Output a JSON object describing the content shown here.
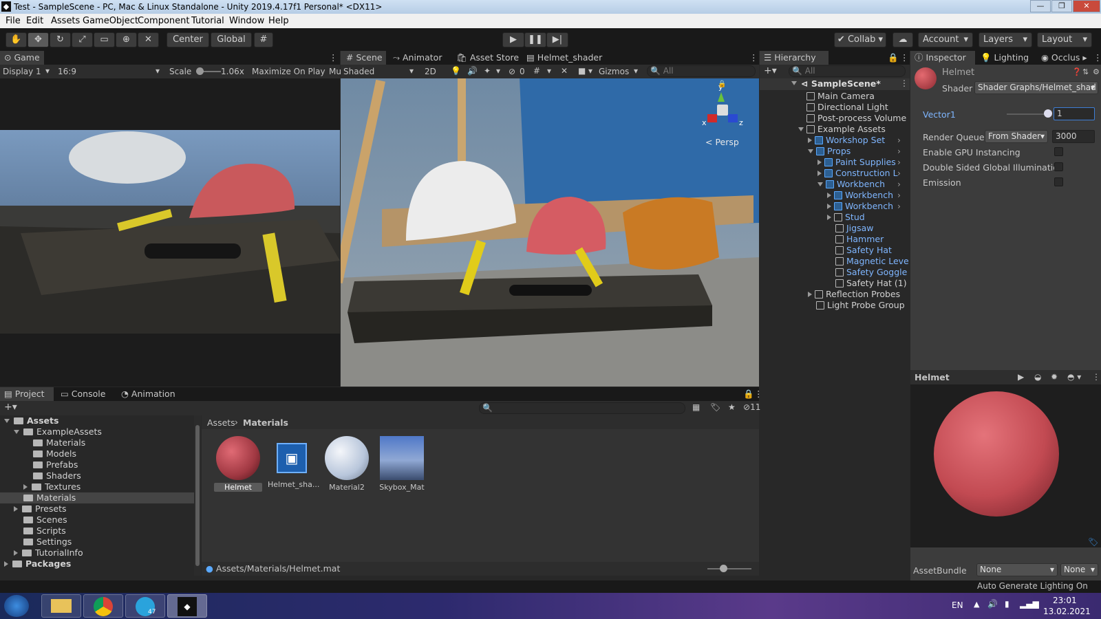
{
  "window": {
    "title": "Test - SampleScene - PC, Mac & Linux Standalone - Unity 2019.4.17f1 Personal* <DX11>",
    "minimize": "—",
    "maximize": "❐",
    "close": "✕"
  },
  "menu": [
    "File",
    "Edit",
    "Assets",
    "GameObject",
    "Component",
    "Tutorial",
    "Window",
    "Help"
  ],
  "toolbar": {
    "center": "Center",
    "global": "Global",
    "collab": "Collab",
    "account": "Account",
    "layers": "Layers",
    "layout": "Layout"
  },
  "game_panel": {
    "tab": "Game",
    "display": "Display 1",
    "aspect": "16:9",
    "scale_label": "Scale",
    "scale_value": "1.06x",
    "maximize": "Maximize On Play",
    "mute": "Mu"
  },
  "scene_panel": {
    "tabs": [
      "Scene",
      "Animator",
      "Asset Store",
      "Helmet_shader"
    ],
    "shading": "Shaded",
    "mode2d": "2D",
    "hidden_count": "0",
    "gizmos": "Gizmos",
    "search_placeholder": "All",
    "persp": "Persp",
    "axis_y": "y",
    "axis_x": "x",
    "axis_z": "z"
  },
  "hierarchy": {
    "tab": "Hierarchy",
    "search_placeholder": "All",
    "scene": "SampleScene*",
    "items": [
      {
        "label": "Main Camera",
        "depth": 1,
        "blue": false,
        "expand": ""
      },
      {
        "label": "Directional Light",
        "depth": 1,
        "blue": false,
        "expand": ""
      },
      {
        "label": "Post-process Volume",
        "depth": 1,
        "blue": false,
        "expand": ""
      },
      {
        "label": "Example Assets",
        "depth": 1,
        "blue": false,
        "expand": "open"
      },
      {
        "label": "Workshop Set",
        "depth": 2,
        "blue": true,
        "expand": "closed",
        "prefab": true
      },
      {
        "label": "Props",
        "depth": 2,
        "blue": true,
        "expand": "open",
        "prefab": true
      },
      {
        "label": "Paint Supplies",
        "depth": 3,
        "blue": true,
        "expand": "closed",
        "prefab": true
      },
      {
        "label": "Construction L",
        "depth": 3,
        "blue": true,
        "expand": "closed",
        "prefab": true
      },
      {
        "label": "Workbench",
        "depth": 3,
        "blue": true,
        "expand": "open",
        "prefab": true
      },
      {
        "label": "Workbench",
        "depth": 4,
        "blue": true,
        "expand": "closed",
        "prefab": true
      },
      {
        "label": "Workbench",
        "depth": 4,
        "blue": true,
        "expand": "closed",
        "prefab": true
      },
      {
        "label": "Stud",
        "depth": 4,
        "blue": true,
        "expand": "closed",
        "prefab": false
      },
      {
        "label": "Jigsaw",
        "depth": 4,
        "blue": true,
        "expand": "",
        "prefab": false
      },
      {
        "label": "Hammer",
        "depth": 4,
        "blue": true,
        "expand": "",
        "prefab": false
      },
      {
        "label": "Safety Hat",
        "depth": 4,
        "blue": true,
        "expand": "",
        "prefab": false
      },
      {
        "label": "Magnetic Leve",
        "depth": 4,
        "blue": true,
        "expand": "",
        "prefab": false
      },
      {
        "label": "Safety Goggle",
        "depth": 4,
        "blue": true,
        "expand": "",
        "prefab": false
      },
      {
        "label": "Safety Hat (1)",
        "depth": 4,
        "blue": false,
        "expand": "",
        "prefab": false
      },
      {
        "label": "Reflection Probes",
        "depth": 2,
        "blue": false,
        "expand": "closed",
        "prefab": false
      },
      {
        "label": "Light Probe Group",
        "depth": 2,
        "blue": false,
        "expand": "",
        "prefab": false
      }
    ]
  },
  "inspector": {
    "tabs": [
      "Inspector",
      "Lighting",
      "Occlus"
    ],
    "object_name": "Helmet",
    "shader_label": "Shader",
    "shader_value": "Shader Graphs/Helmet_shad",
    "vector1_label": "Vector1",
    "vector1_value": "1",
    "render_queue_label": "Render Queue",
    "render_queue_mode": "From Shader",
    "render_queue_value": "3000",
    "gpu_instancing": "Enable GPU Instancing",
    "double_sided": "Double Sided Global Illumination",
    "emission": "Emission",
    "preview_title": "Helmet",
    "assetbundle_label": "AssetBundle",
    "assetbundle_value": "None",
    "assetbundle_variant": "None",
    "auto_lighting": "Auto Generate Lighting On"
  },
  "project": {
    "tabs": [
      "Project",
      "Console",
      "Animation"
    ],
    "hidden_count": "11",
    "breadcrumb": [
      "Assets",
      "Materials"
    ],
    "path": "Assets/Materials/Helmet.mat",
    "tree": [
      {
        "label": "Assets",
        "depth": 0,
        "expand": "open",
        "bold": true
      },
      {
        "label": "ExampleAssets",
        "depth": 1,
        "expand": "open",
        "bold": false
      },
      {
        "label": "Materials",
        "depth": 2,
        "expand": "",
        "bold": false
      },
      {
        "label": "Models",
        "depth": 2,
        "expand": "",
        "bold": false
      },
      {
        "label": "Prefabs",
        "depth": 2,
        "expand": "",
        "bold": false
      },
      {
        "label": "Shaders",
        "depth": 2,
        "expand": "",
        "bold": false
      },
      {
        "label": "Textures",
        "depth": 2,
        "expand": "closed",
        "bold": false
      },
      {
        "label": "Materials",
        "depth": 1,
        "expand": "",
        "bold": false,
        "selected": true
      },
      {
        "label": "Presets",
        "depth": 1,
        "expand": "closed",
        "bold": false
      },
      {
        "label": "Scenes",
        "depth": 1,
        "expand": "",
        "bold": false
      },
      {
        "label": "Scripts",
        "depth": 1,
        "expand": "",
        "bold": false
      },
      {
        "label": "Settings",
        "depth": 1,
        "expand": "",
        "bold": false
      },
      {
        "label": "TutorialInfo",
        "depth": 1,
        "expand": "closed",
        "bold": false
      },
      {
        "label": "Packages",
        "depth": 0,
        "expand": "closed",
        "bold": true
      }
    ],
    "assets": [
      {
        "label": "Helmet",
        "kind": "red-sphere"
      },
      {
        "label": "Helmet_sha...",
        "kind": "shader-graph"
      },
      {
        "label": "Material2",
        "kind": "white-sphere"
      },
      {
        "label": "Skybox_Mat",
        "kind": "skybox"
      }
    ]
  },
  "taskbar": {
    "lang": "EN",
    "time": "23:01",
    "date": "13.02.2021",
    "badge": "47"
  }
}
